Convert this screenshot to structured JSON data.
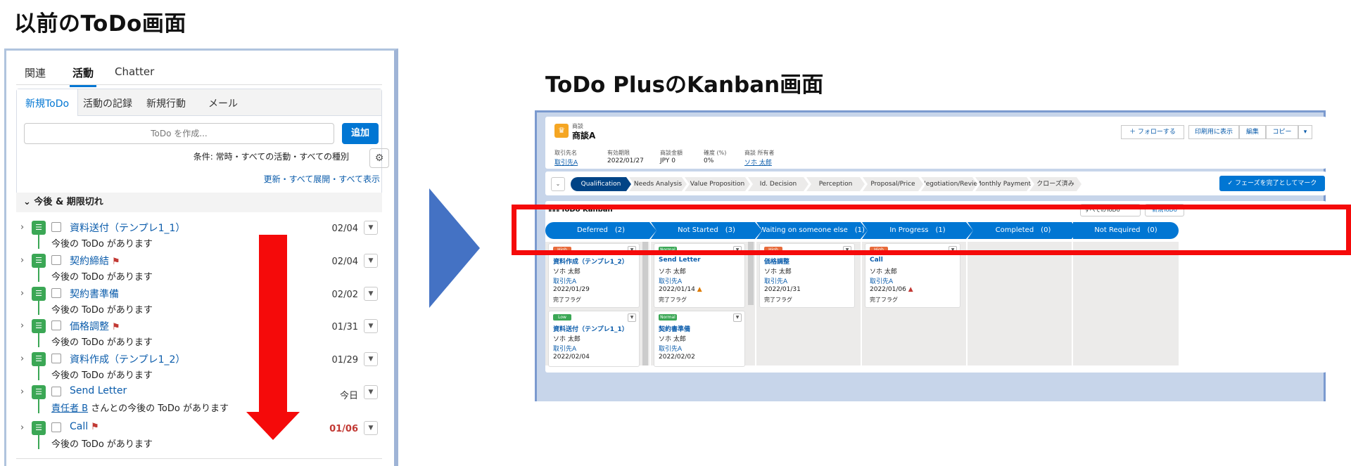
{
  "titles": {
    "left": "以前のToDo画面",
    "right": "ToDo PlusのKanban画面"
  },
  "old": {
    "tabs": [
      "関連",
      "活動",
      "Chatter"
    ],
    "subtabs": [
      "新規ToDo",
      "活動の記録",
      "新規行動",
      "メール"
    ],
    "input_placeholder": "ToDo を作成...",
    "add_label": "追加",
    "filter": "条件: 常時・すべての活動・すべての種別",
    "links": "更新・すべて展開・すべて表示",
    "section": "今後 & 期限切れ",
    "tasks": [
      {
        "name": "資料送付（テンプレ1_1）",
        "sub": "今後の ToDo があります",
        "date": "02/04",
        "flag": false
      },
      {
        "name": "契約締結",
        "sub": "今後の ToDo があります",
        "date": "02/04",
        "flag": true
      },
      {
        "name": "契約書準備",
        "sub": "今後の ToDo があります",
        "date": "02/02",
        "flag": false
      },
      {
        "name": "価格調整",
        "sub": "今後の ToDo があります",
        "date": "01/31",
        "flag": true
      },
      {
        "name": "資料作成（テンプレ1_2）",
        "sub": "今後の ToDo があります",
        "date": "01/29",
        "flag": false
      },
      {
        "name": "Send Letter",
        "owner": "責任者 B",
        "sub": "さんとの今後の ToDo があります",
        "date": "今日",
        "flag": false
      },
      {
        "name": "Call",
        "sub": "今後の ToDo があります",
        "date": "01/06",
        "flag": true,
        "overdue": true
      }
    ]
  },
  "opp": {
    "type_label": "商談",
    "name": "商談A",
    "follow": "＋ フォローする",
    "print": "印刷用に表示",
    "edit": "編集",
    "copy": "コピー",
    "fields": [
      {
        "label": "取引先名",
        "value": "取引先A",
        "link": true
      },
      {
        "label": "有効期限",
        "value": "2022/01/27",
        "link": false
      },
      {
        "label": "商談金額",
        "value": "JPY 0",
        "link": false
      },
      {
        "label": "確度 (%)",
        "value": "0%",
        "link": false
      },
      {
        "label": "商談 所有者",
        "value": "ソホ 太郎",
        "link": true
      }
    ],
    "stages": [
      "Qualification",
      "Needs Analysis",
      "Value Proposition",
      "Id. Decision Makers",
      "Perception Analysis",
      "Proposal/Price Quote",
      "Negotiation/Review",
      "Monthly Payment C...",
      "クローズ済み"
    ],
    "mark_complete": "✓ フェーズを完了としてマーク",
    "kanban_title": "ToDo Kanban",
    "kanban_filter": "すべてのToDo",
    "kanban_new": "新規ToDo",
    "columns": [
      {
        "label": "Deferred　(2)"
      },
      {
        "label": "Not Started　(3)"
      },
      {
        "label": "Waiting on someone else　(1)"
      },
      {
        "label": "In Progress　(1)"
      },
      {
        "label": "Completed　(0)"
      },
      {
        "label": "Not Required　(0)"
      }
    ],
    "cards": [
      {
        "priority": "High",
        "name": "資料作成（テンプレ1_2）",
        "owner": "ソホ 太郎",
        "account": "取引先A",
        "date": "2022/01/29",
        "flag": "完了フラグ"
      },
      {
        "priority": "Low",
        "name": "資料送付（テンプレ1_1）",
        "owner": "ソホ 太郎",
        "account": "取引先A",
        "date": "2022/02/04",
        "flag": "完了フラグ"
      },
      {
        "priority": "Normal",
        "name": "Send Letter",
        "owner": "ソホ 太郎",
        "account": "取引先A",
        "date": "2022/01/14",
        "flag": "完了フラグ"
      },
      {
        "priority": "Normal",
        "name": "契約書準備",
        "owner": "ソホ 太郎",
        "account": "取引先A",
        "date": "2022/02/02",
        "flag": "完了フラグ"
      },
      {
        "priority": "High",
        "name": "価格調整",
        "owner": "ソホ 太郎",
        "account": "取引先A",
        "date": "2022/01/31",
        "flag": "完了フラグ"
      },
      {
        "priority": "High",
        "name": "Call",
        "owner": "ソホ 太郎",
        "account": "取引先A",
        "date": "2022/01/06",
        "flag": "完了フラグ"
      }
    ]
  }
}
